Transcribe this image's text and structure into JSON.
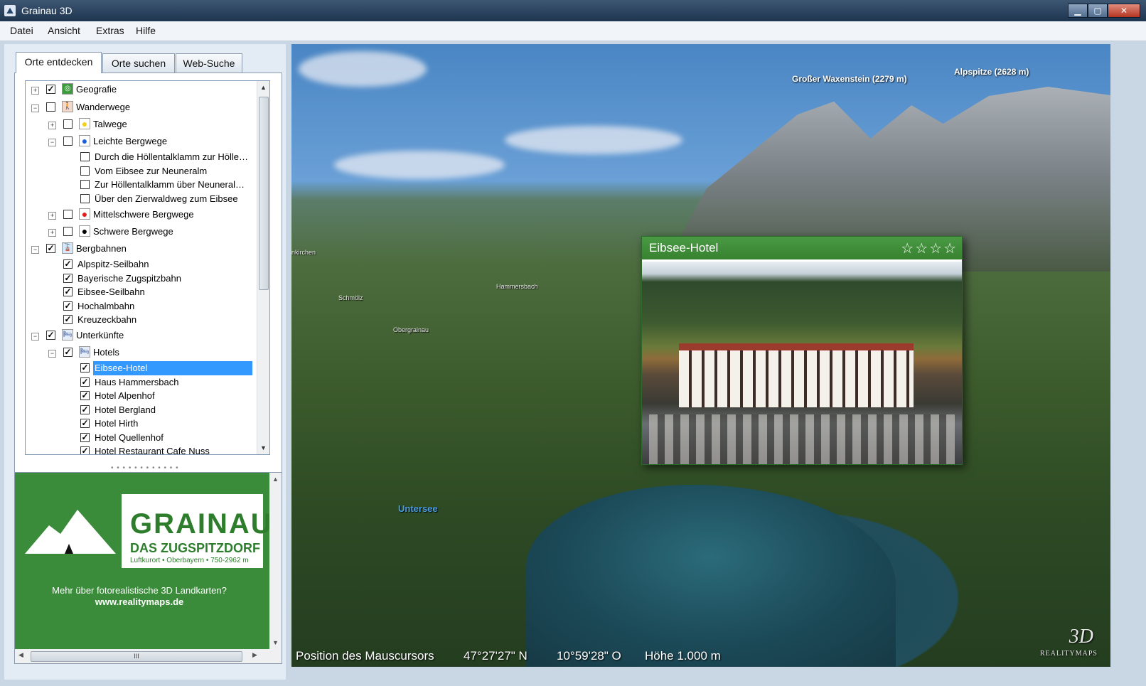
{
  "window": {
    "title": "Grainau 3D",
    "minimize": "▁",
    "maximize": "▢",
    "close": "✕"
  },
  "menu": [
    "Datei",
    "Ansicht",
    "Extras",
    "Hilfe"
  ],
  "tabs": [
    "Orte entdecken",
    "Orte suchen",
    "Web-Suche"
  ],
  "tree": [
    {
      "label": "Geografie",
      "checked": true
    },
    {
      "label": "Wanderwege",
      "checked": false
    },
    {
      "label": "Talwege",
      "checked": false
    },
    {
      "label": "Leichte Bergwege",
      "checked": false
    },
    {
      "label": "Durch die Höllentalklamm zur Hölle…",
      "checked": false
    },
    {
      "label": "Vom Eibsee zur Neuneralm",
      "checked": false
    },
    {
      "label": "Zur Höllentalklamm über Neuneral…",
      "checked": false
    },
    {
      "label": "Über den Zierwaldweg zum Eibsee",
      "checked": false
    },
    {
      "label": "Mittelschwere Bergwege",
      "checked": false
    },
    {
      "label": "Schwere Bergwege",
      "checked": false
    },
    {
      "label": "Bergbahnen",
      "checked": true
    },
    {
      "label": "Alpspitz-Seilbahn",
      "checked": true
    },
    {
      "label": "Bayerische Zugspitzbahn",
      "checked": true
    },
    {
      "label": "Eibsee-Seilbahn",
      "checked": true
    },
    {
      "label": "Hochalmbahn",
      "checked": true
    },
    {
      "label": "Kreuzeckbahn",
      "checked": true
    },
    {
      "label": "Unterkünfte",
      "checked": true
    },
    {
      "label": "Hotels",
      "checked": true
    },
    {
      "label": "Eibsee-Hotel",
      "checked": true,
      "selected": true
    },
    {
      "label": "Haus Hammersbach",
      "checked": true
    },
    {
      "label": "Hotel Alpenhof",
      "checked": true
    },
    {
      "label": "Hotel Bergland",
      "checked": true
    },
    {
      "label": "Hotel Hirth",
      "checked": true
    },
    {
      "label": "Hotel Quellenhof",
      "checked": true
    },
    {
      "label": "Hotel Restaurant Cafe Nuss",
      "checked": true
    }
  ],
  "ad": {
    "brand": "GRAINAU",
    "tagline": "DAS ZUGSPITZDORF",
    "small": "Luftkurort • Oberbayern • 750-2962 m",
    "text": "Mehr über fotorealistische 3D Landkarten?",
    "url": "www.realitymaps.de",
    "hscroll_grip": "III"
  },
  "map": {
    "peaks": [
      "Großer Waxenstein (2279 m)",
      "Alpspitze (2628 m)"
    ],
    "places": [
      "nkirchen",
      "Hammersbach",
      "Obergrainau",
      "Schmölz"
    ],
    "lake": "Untersee",
    "popup": {
      "title": "Eibsee-Hotel",
      "stars": "☆☆☆☆"
    },
    "status": {
      "label": "Position des Mauscursors",
      "lat": "47°27'27\" N",
      "lon": "10°59'28\" O",
      "height": "Höhe 1.000 m"
    },
    "brand": "3D",
    "brand_sub": "REALITYMAPS"
  }
}
